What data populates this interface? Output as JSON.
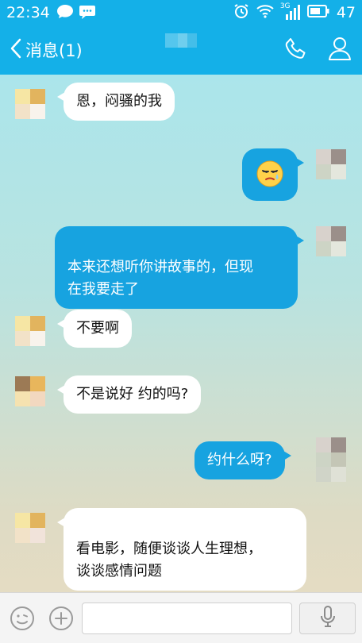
{
  "status_bar": {
    "time": "22:34",
    "battery": "47",
    "network": "3G"
  },
  "nav": {
    "back_label": "消息(1)",
    "icons": [
      "chevron-left-icon",
      "phone-icon",
      "person-icon"
    ]
  },
  "messages": [
    {
      "from": "other",
      "text": "恩，闷骚的我"
    },
    {
      "from": "me",
      "text": "",
      "emoji": "crying-face-emoji"
    },
    {
      "from": "me",
      "text": "本来还想听你讲故事的，但现\n在我要走了"
    },
    {
      "from": "other",
      "text": "不要啊"
    },
    {
      "from": "other",
      "text": "不是说好 约的吗?"
    },
    {
      "from": "me",
      "text": "约什么呀?"
    },
    {
      "from": "other",
      "text": "看电影，随便谈谈人生理想，\n谈谈感情问题"
    }
  ],
  "input_bar": {
    "icons": [
      "emoji-icon",
      "add-icon",
      "microphone-icon"
    ],
    "text_value": ""
  },
  "colors": {
    "primary": "#14b0e8",
    "bubble_out": "#17a3e0",
    "bubble_in": "#ffffff"
  }
}
